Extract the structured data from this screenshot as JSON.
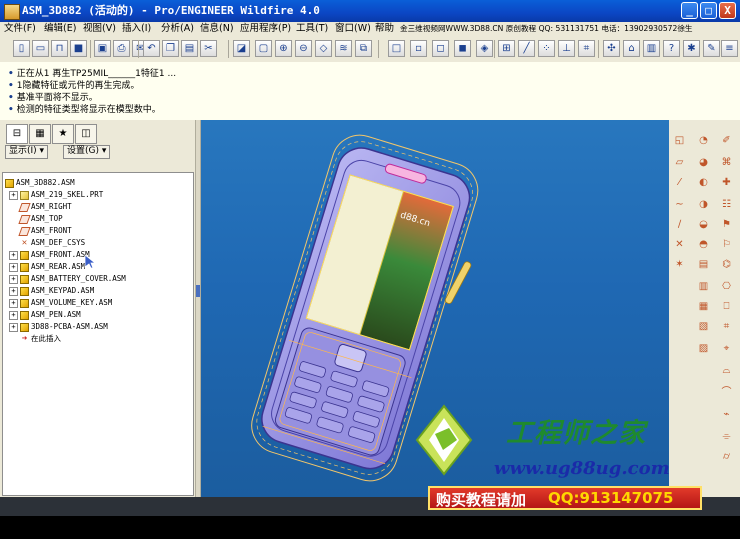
{
  "window": {
    "title": "ASM_3D882 (活动的) - Pro/ENGINEER Wildfire 4.0",
    "buttons": {
      "minimize": "_",
      "maximize": "□",
      "close": "X"
    }
  },
  "menubar": {
    "items": [
      "文件(F)",
      "编辑(E)",
      "视图(V)",
      "插入(I)",
      "分析(A)",
      "信息(N)",
      "应用程序(P)",
      "工具(T)",
      "窗口(W)",
      "帮助"
    ],
    "banner": "金三维视频网WWW.3D88.CN 原创教程 QQ: 531131751 电话：13902930572徐生"
  },
  "messages": [
    "正在从1 再生TP25MIL______1特征1 ...",
    "1隐藏特征或元件的再生完成。",
    "基准平面将不显示。",
    "检测的特征类型将显示在模型数中。"
  ],
  "tree": {
    "show_label": "显示(I) ▾",
    "settings_label": "设置(G) ▾",
    "items": [
      {
        "label": "ASM_3D882.ASM",
        "icon": "assembly-icon"
      },
      {
        "label": "ASM_219_SKEL.PRT",
        "icon": "part-icon"
      },
      {
        "label": "ASM_RIGHT",
        "icon": "datum-plane-icon"
      },
      {
        "label": "ASM_TOP",
        "icon": "datum-plane-icon"
      },
      {
        "label": "ASM_FRONT",
        "icon": "datum-plane-icon"
      },
      {
        "label": "ASM_DEF_CSYS",
        "icon": "csys-icon"
      },
      {
        "label": "ASM_FRONT.ASM",
        "icon": "assembly-icon"
      },
      {
        "label": "ASM_REAR.ASM",
        "icon": "assembly-icon"
      },
      {
        "label": "ASM_BATTERY_COVER.ASM",
        "icon": "assembly-icon"
      },
      {
        "label": "ASM_KEYPAD.ASM",
        "icon": "assembly-icon"
      },
      {
        "label": "ASM_VOLUME_KEY.ASM",
        "icon": "assembly-icon"
      },
      {
        "label": "ASM_PEN.ASM",
        "icon": "assembly-icon"
      },
      {
        "label": "3D88-PCBA-ASM.ASM",
        "icon": "assembly-icon"
      },
      {
        "label": "在此插入",
        "icon": "insert-here-arrow-icon"
      }
    ]
  },
  "viewport": {
    "screen_text": "d88.cn"
  },
  "watermark": {
    "brand_cn": "工程师之家",
    "url": "www.ug88ug.com",
    "buy_label": "购买教程请加",
    "qq_label": "QQ:913147075",
    "colors": {
      "brand": "#1f8a2e",
      "url": "#1a2aa8",
      "buy_bg": "#c81f1f",
      "qq": "#ffd700"
    }
  }
}
